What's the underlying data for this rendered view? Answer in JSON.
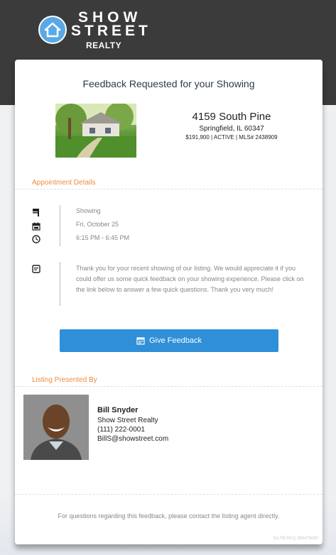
{
  "brand": {
    "line1": "SHOW",
    "line2": "STREET",
    "line3": "REALTY"
  },
  "title": "Feedback Requested for your Showing",
  "property": {
    "address": "4159 South Pine",
    "city": "Springfield, IL 60347",
    "meta": "$191,900 | ACTIVE | MLS# 2438909"
  },
  "appointment": {
    "heading": "Appointment Details",
    "type": "Showing",
    "date": "Fri, October 25",
    "time": "6:15 PM - 6:45 PM",
    "message": "Thank you for your recent showing of our listing. We would appreciate it if you could offer us some quick feedback on your showing experience. Please click on the link below to answer a few quick questions. Thank you very much!"
  },
  "button": {
    "label": "Give Feedback"
  },
  "listing": {
    "heading": "Listing Presented By",
    "name": "Bill Snyder",
    "company": "Show Street Realty",
    "phone": "(111) 222-0001",
    "email": "BillS@showstreet.com"
  },
  "footer": "For questions regarding this feedback, please contact the listing agent directly.",
  "reference": "SA.FB.REQ.386476080",
  "colors": {
    "header_bg": "#3b3b3b",
    "accent": "#f08a3c",
    "button": "#2f8fd8",
    "logo_circle": "#5aa9e6"
  }
}
